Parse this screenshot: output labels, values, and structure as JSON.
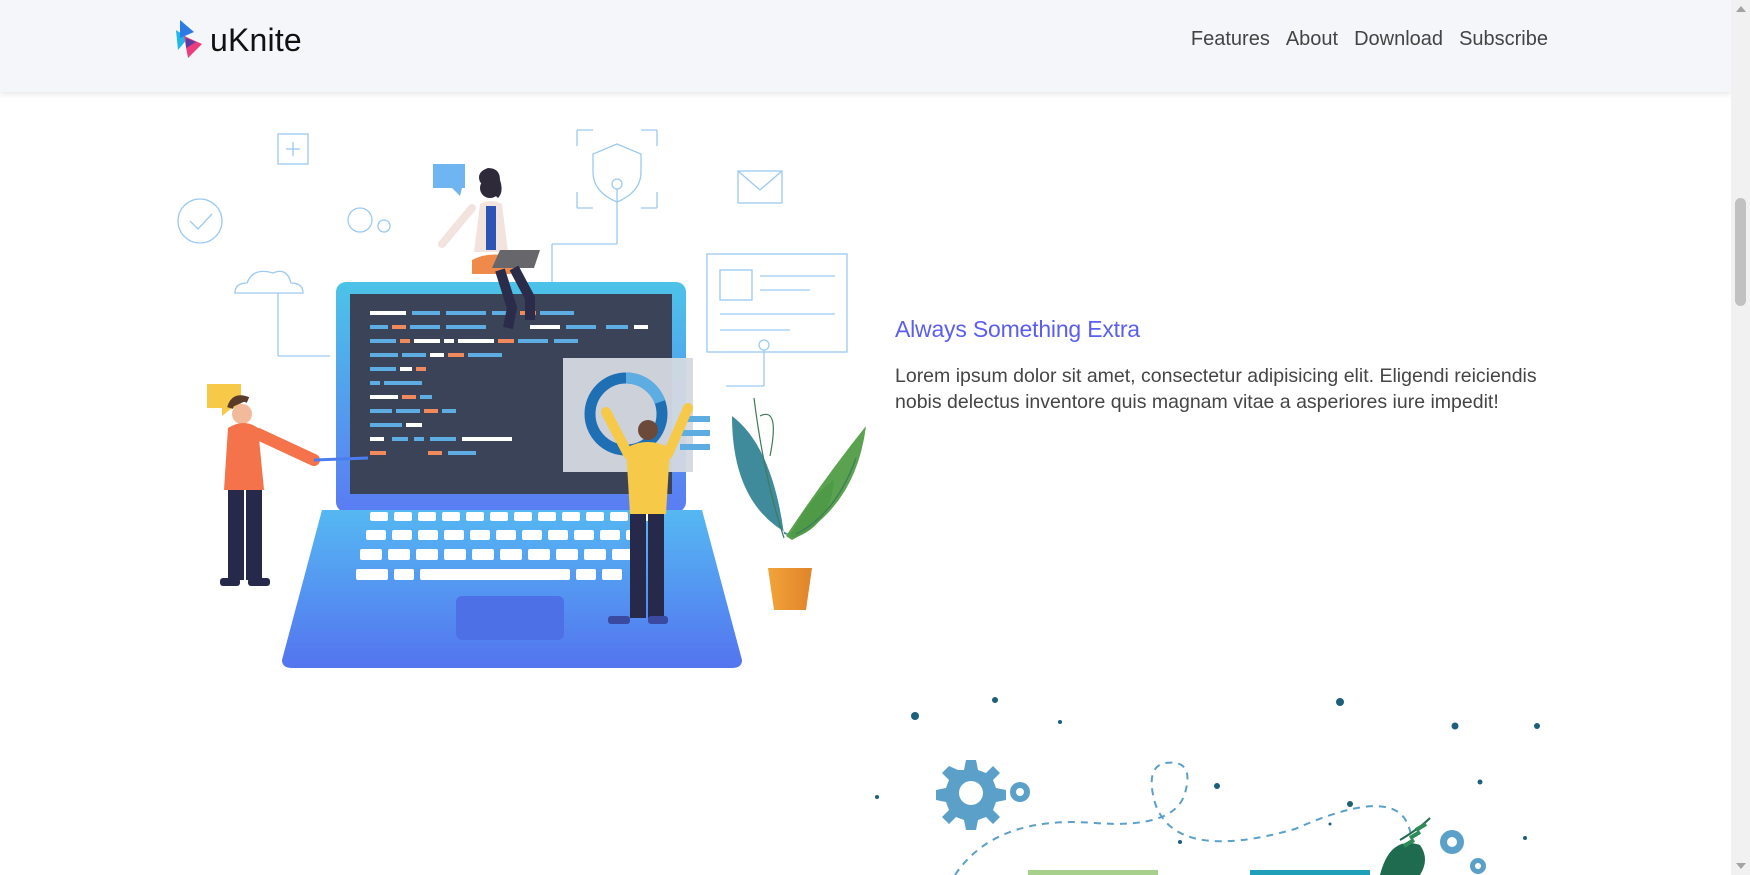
{
  "brand": {
    "name": "uKnite"
  },
  "nav": {
    "features": "Features",
    "about": "About",
    "download": "Download",
    "subscribe": "Subscribe"
  },
  "feature": {
    "title": "Always Something Extra",
    "description": "Lorem ipsum dolor sit amet, consectetur adipisicing elit. Eligendi reiciendis nobis delectus inventore quis magnam vitae a asperiores iure impedit!"
  },
  "colors": {
    "accent": "#5b5ef0",
    "navbar_bg": "#f5f6f9",
    "text": "#454545",
    "laptop_blue": "#4f8ff7",
    "plant_green": "#4e9a47"
  },
  "icons": [
    "logo-icon",
    "scrollbar-up-arrow-icon",
    "scrollbar-down-arrow-icon"
  ]
}
